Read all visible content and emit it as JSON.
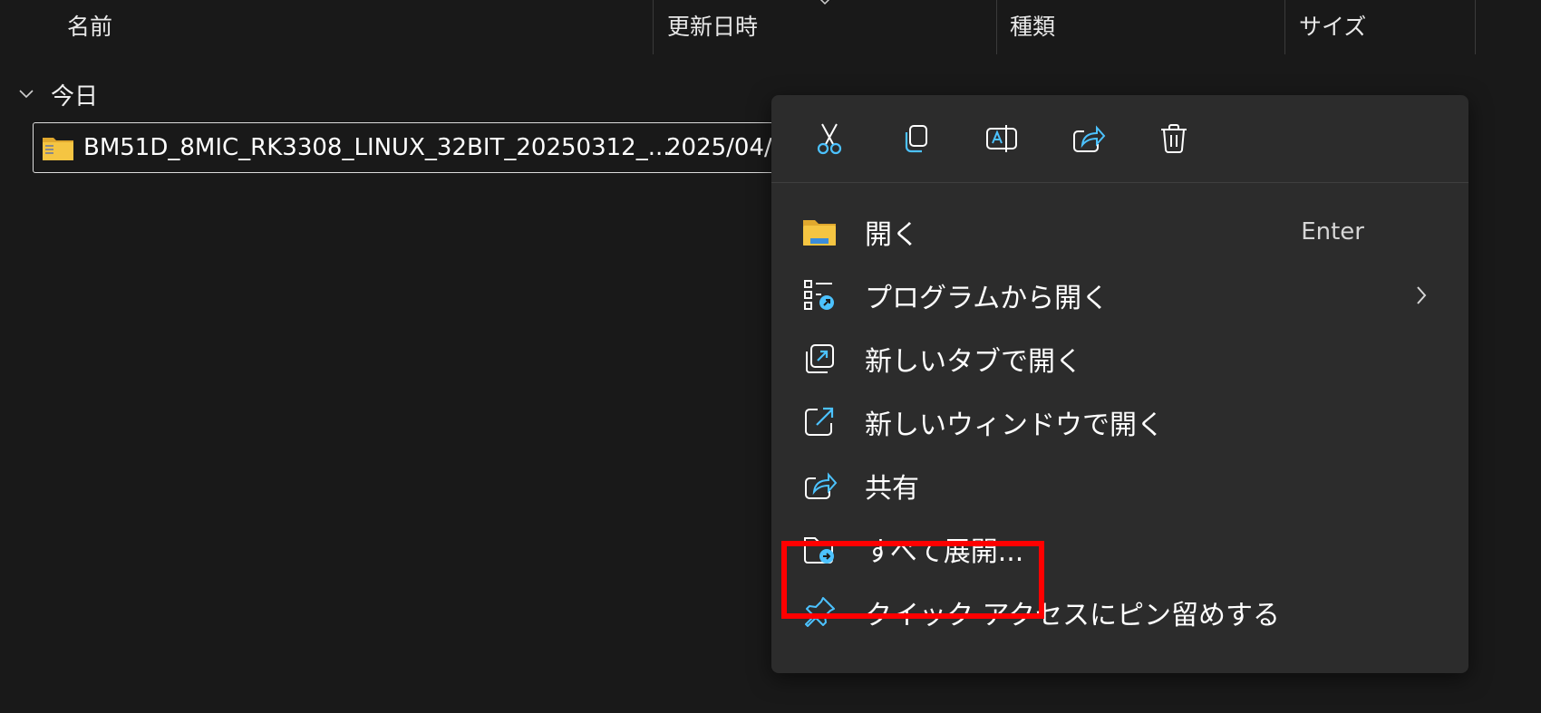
{
  "columns": {
    "name": "名前",
    "modified": "更新日時",
    "type": "種類",
    "size": "サイズ"
  },
  "group": {
    "label": "今日"
  },
  "file": {
    "name": "BM51D_8MIC_RK3308_LINUX_32BIT_20250312_...",
    "date": "2025/04/"
  },
  "toolbar": {
    "icons": [
      "cut-icon",
      "copy-icon",
      "rename-icon",
      "share-icon",
      "delete-icon"
    ]
  },
  "menu": {
    "items": [
      {
        "label": "開く",
        "accelerator": "Enter"
      },
      {
        "label": "プログラムから開く"
      },
      {
        "label": "新しいタブで開く"
      },
      {
        "label": "新しいウィンドウで開く"
      },
      {
        "label": "共有"
      },
      {
        "label": "すべて展開..."
      },
      {
        "label": "クイック アクセスにピン留めする"
      }
    ]
  },
  "colors": {
    "background": "#191919",
    "menu_background": "#2c2c2c",
    "icon_accent": "#4cc2ff",
    "folder_yellow": "#f5c542",
    "highlight": "#ff0000"
  }
}
